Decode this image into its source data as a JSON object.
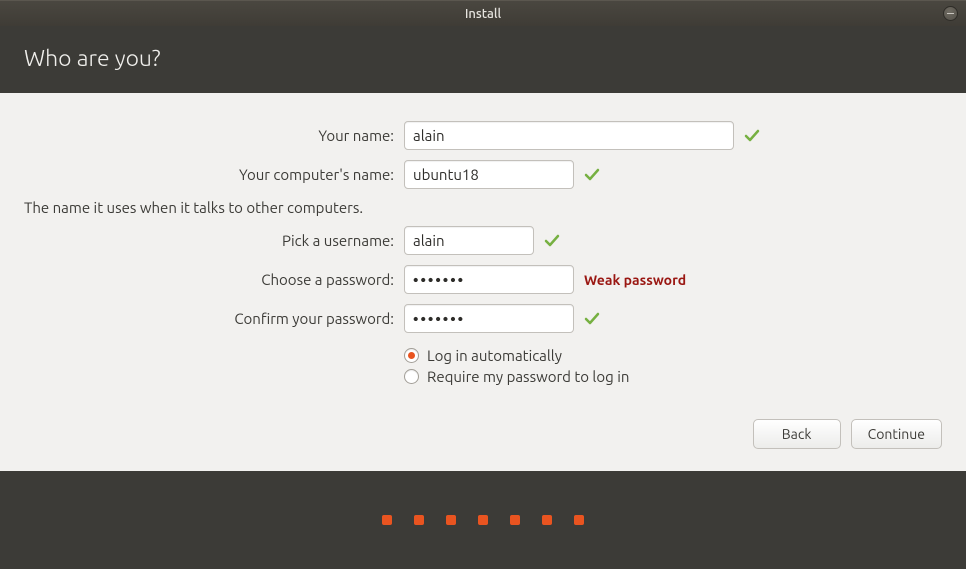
{
  "window": {
    "title": "Install"
  },
  "header": {
    "title": "Who are you?"
  },
  "form": {
    "name_label": "Your name:",
    "name_value": "alain",
    "computer_label": "Your computer's name:",
    "computer_value": "ubuntu18",
    "computer_hint": "The name it uses when it talks to other computers.",
    "username_label": "Pick a username:",
    "username_value": "alain",
    "password_label": "Choose a password:",
    "password_value": "•••••••",
    "password_strength": "Weak password",
    "confirm_label": "Confirm your password:",
    "confirm_value": "•••••••",
    "login_auto": "Log in automatically",
    "login_require": "Require my password to log in",
    "login_choice": "auto"
  },
  "buttons": {
    "back": "Back",
    "continue": "Continue"
  },
  "progress": {
    "total_dots": 7
  }
}
